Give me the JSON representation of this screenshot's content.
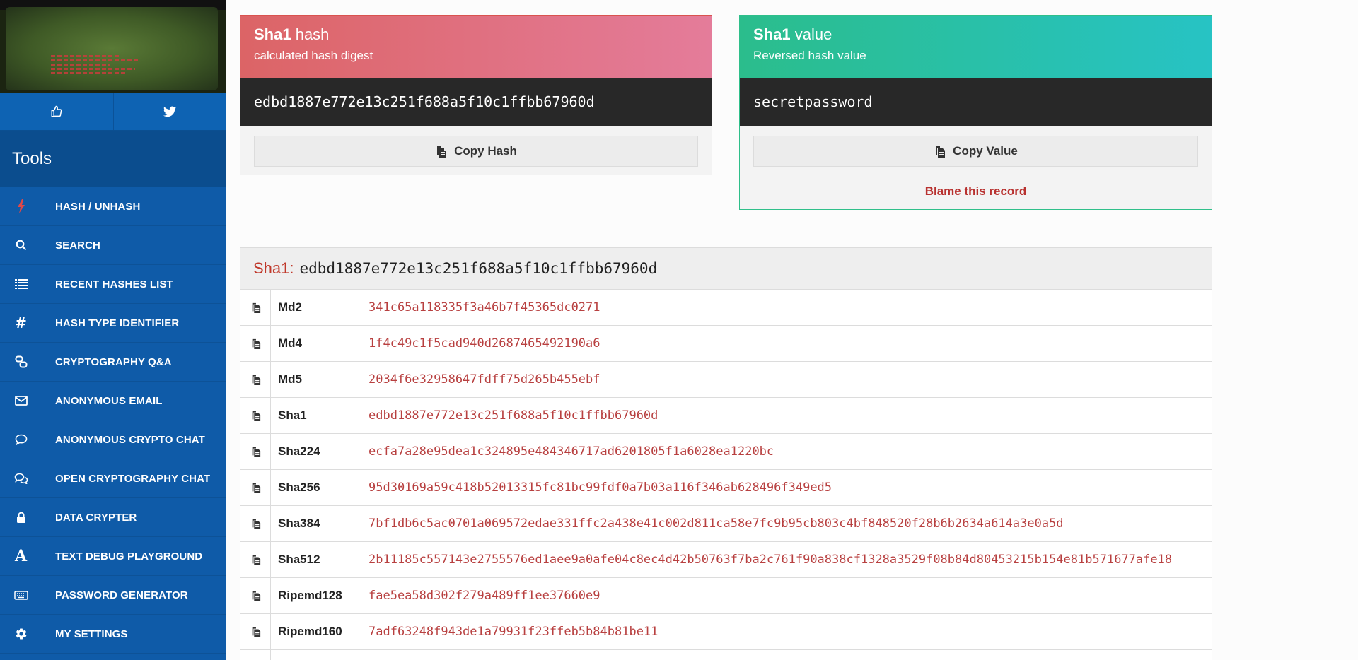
{
  "sidebar": {
    "tools_title": "Tools",
    "items": [
      {
        "icon": "bolt-icon",
        "label": "HASH / UNHASH"
      },
      {
        "icon": "search-icon",
        "label": "SEARCH"
      },
      {
        "icon": "list-icon",
        "label": "RECENT HASHES LIST"
      },
      {
        "icon": "hash-icon",
        "label": "HASH TYPE IDENTIFIER"
      },
      {
        "icon": "qa-icon",
        "label": "CRYPTOGRAPHY Q&A"
      },
      {
        "icon": "envelope-icon",
        "label": "ANONYMOUS EMAIL"
      },
      {
        "icon": "chat-icon",
        "label": "ANONYMOUS CRYPTO CHAT"
      },
      {
        "icon": "chats-icon",
        "label": "OPEN CRYPTOGRAPHY CHAT"
      },
      {
        "icon": "lock-icon",
        "label": "DATA CRYPTER"
      },
      {
        "icon": "font-icon",
        "label": "TEXT DEBUG PLAYGROUND"
      },
      {
        "icon": "keyboard-icon",
        "label": "PASSWORD GENERATOR"
      },
      {
        "icon": "gear-icon",
        "label": "MY SETTINGS"
      }
    ]
  },
  "hash_card": {
    "title_bold": "Sha1",
    "title_rest": " hash",
    "subtitle": "calculated hash digest",
    "value": "edbd1887e772e13c251f688a5f10c1ffbb67960d",
    "button": "Copy Hash"
  },
  "value_card": {
    "title_bold": "Sha1",
    "title_rest": " value",
    "subtitle": "Reversed hash value",
    "value": "secretpassword",
    "button": "Copy Value",
    "blame": "Blame this record"
  },
  "table": {
    "algo": "Sha1:",
    "hash": "edbd1887e772e13c251f688a5f10c1ffbb67960d",
    "rows": [
      {
        "name": "Md2",
        "value": "341c65a118335f3a46b7f45365dc0271"
      },
      {
        "name": "Md4",
        "value": "1f4c49c1f5cad940d2687465492190a6"
      },
      {
        "name": "Md5",
        "value": "2034f6e32958647fdff75d265b455ebf"
      },
      {
        "name": "Sha1",
        "value": "edbd1887e772e13c251f688a5f10c1ffbb67960d"
      },
      {
        "name": "Sha224",
        "value": "ecfa7a28e95dea1c324895e484346717ad6201805f1a6028ea1220bc"
      },
      {
        "name": "Sha256",
        "value": "95d30169a59c418b52013315fc81bc99fdf0a7b03a116f346ab628496f349ed5"
      },
      {
        "name": "Sha384",
        "value": "7bf1db6c5ac0701a069572edae331ffc2a438e41c002d811ca58e7fc9b95cb803c4bf848520f28b6b2634a614a3e0a5d"
      },
      {
        "name": "Sha512",
        "value": "2b11185c557143e2755576ed1aee9a0afe04c8ec4d42b50763f7ba2c761f90a838cf1328a3529f08b84d80453215b154e81b571677afe18"
      },
      {
        "name": "Ripemd128",
        "value": "fae5ea58d302f279a489ff1ee37660e9"
      },
      {
        "name": "Ripemd160",
        "value": "7adf63248f943de1a79931f23ffeb5b84b81be11"
      },
      {
        "name": "",
        "value": ""
      }
    ]
  }
}
